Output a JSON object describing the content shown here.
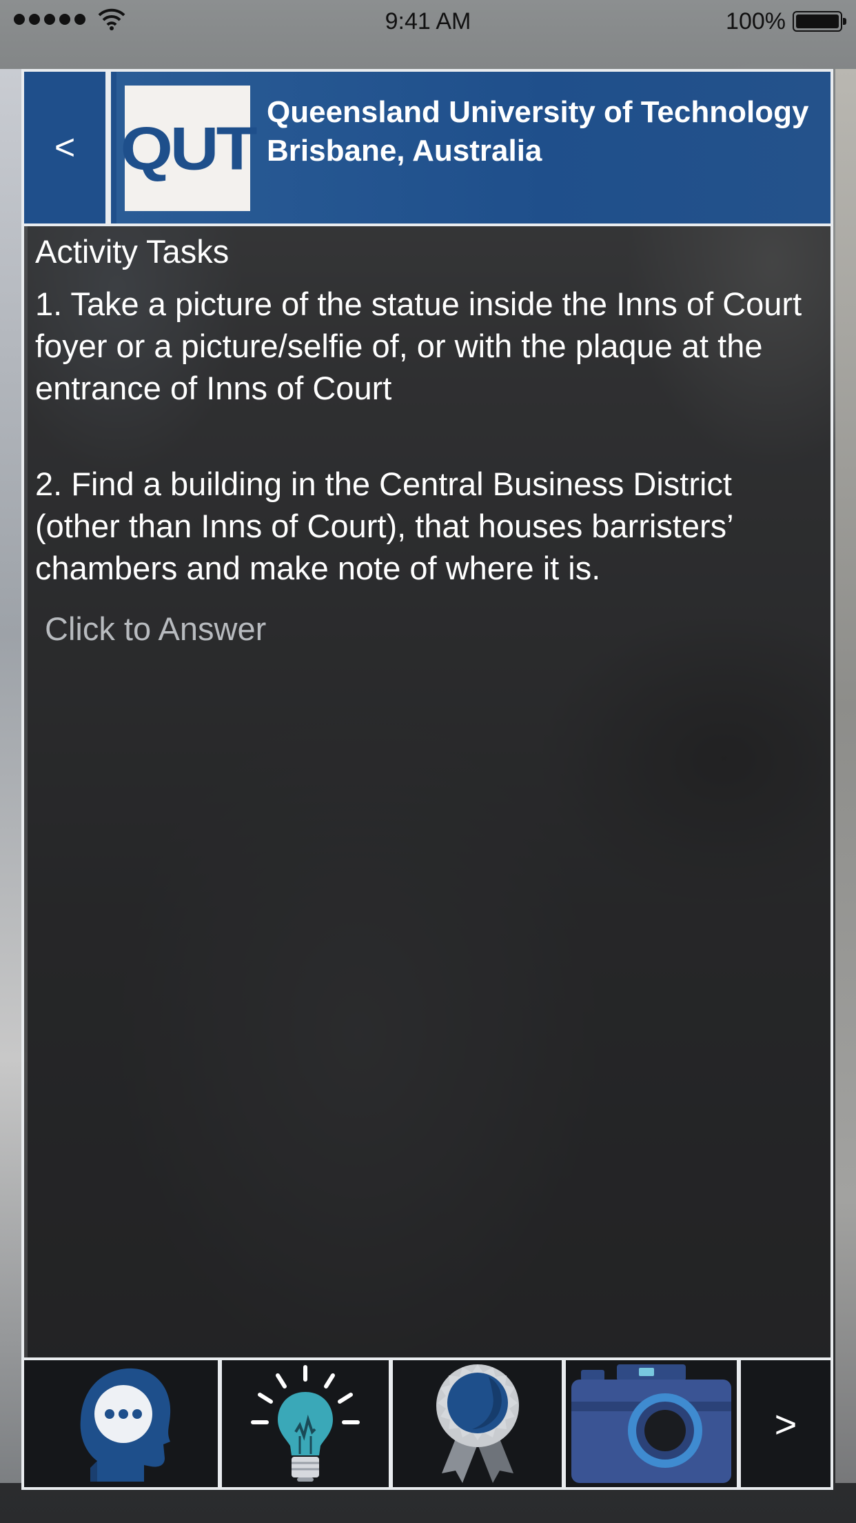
{
  "status_bar": {
    "time": "9:41 AM",
    "battery": "100%"
  },
  "header": {
    "back_label": "<",
    "logo_text": "QUT",
    "title_line1": "Queensland University of Technology",
    "title_line2": "Brisbane, Australia"
  },
  "content": {
    "section_title": "Activity Tasks",
    "tasks": [
      "1. Take a picture of the statue inside the Inns of Court foyer or a picture/selfie of, or with the plaque at the entrance of Inns of Court",
      "2. Find a building in the Central Business District (other than Inns of Court), that houses barristers’ chambers and make note of where it is."
    ],
    "answer_link": "Click to Answer"
  },
  "toolbar": {
    "items": [
      {
        "icon": "thinking-head-icon"
      },
      {
        "icon": "lightbulb-icon"
      },
      {
        "icon": "award-ribbon-icon"
      },
      {
        "icon": "camera-icon"
      }
    ],
    "next_label": ">"
  },
  "colors": {
    "header_blue": "#1f4f8b",
    "frame_border": "#e9ecef",
    "icon_blue": "#1e4f8b",
    "bulb_teal": "#3aa8b8"
  }
}
